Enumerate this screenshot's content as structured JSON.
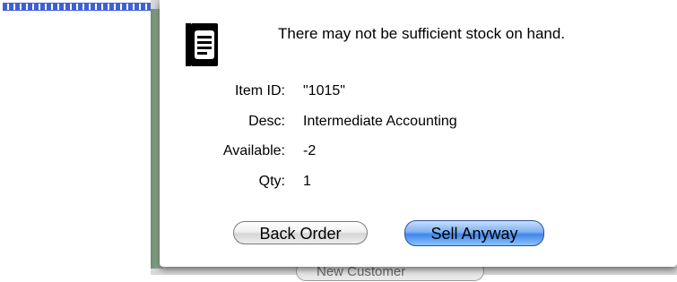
{
  "alert": {
    "message": "There may not be sufficient stock on hand.",
    "fields": [
      {
        "label": "Item ID:",
        "value": "\"1015\""
      },
      {
        "label": "Desc:",
        "value": "Intermediate Accounting"
      },
      {
        "label": "Available:",
        "value": "-2"
      },
      {
        "label": "Qty:",
        "value": "1"
      }
    ],
    "buttons": {
      "back_order": "Back Order",
      "sell_anyway": "Sell Anyway"
    }
  },
  "background": {
    "new_customer_label": "New Customer"
  },
  "icons": {
    "alert": "document-alert-icon"
  },
  "colors": {
    "default_button": "#5b9cf0",
    "secondary_button": "#e6e6e6"
  }
}
